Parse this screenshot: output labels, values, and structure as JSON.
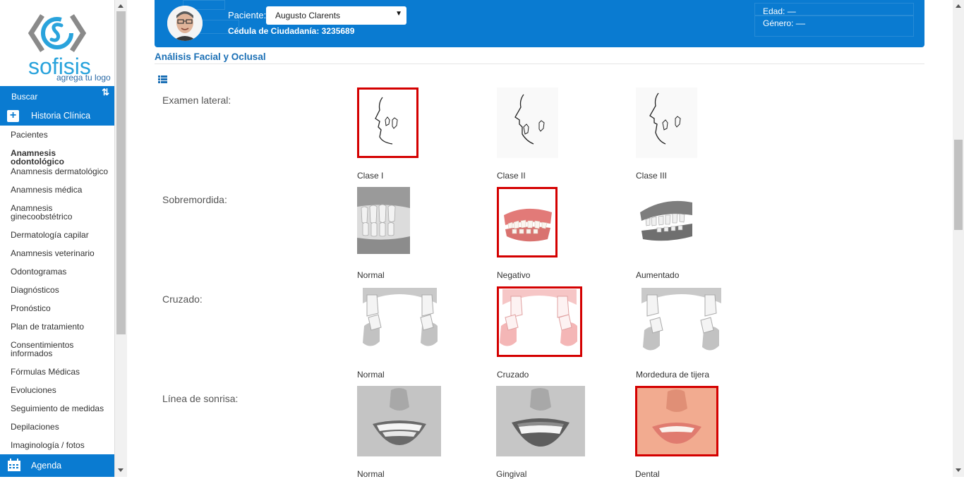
{
  "sidebar": {
    "logo": {
      "brand": "sofisis",
      "tagline": "agrega tu logo"
    },
    "search_label": "Buscar",
    "section_label": "Historia Clínica",
    "items": [
      {
        "label": "Pacientes"
      },
      {
        "label": "Anamnesis odontológico"
      },
      {
        "label": "Anamnesis dermatológico"
      },
      {
        "label": "Anamnesis médica"
      },
      {
        "label": "Anamnesis ginecoobstétrico"
      },
      {
        "label": "Dermatología capilar"
      },
      {
        "label": "Anamnesis veterinario"
      },
      {
        "label": "Odontogramas"
      },
      {
        "label": "Diagnósticos"
      },
      {
        "label": "Pronóstico"
      },
      {
        "label": "Plan de tratamiento"
      },
      {
        "label": "Consentimientos informados"
      },
      {
        "label": "Fórmulas Médicas"
      },
      {
        "label": "Evoluciones"
      },
      {
        "label": "Seguimiento de medidas"
      },
      {
        "label": "Depilaciones"
      },
      {
        "label": "Imaginología / fotos"
      }
    ],
    "active_item": "Anamnesis odontológico",
    "agenda_label": "Agenda"
  },
  "patient": {
    "label": "Paciente:",
    "selected": "Augusto Clarents",
    "cedula": "Cédula de Ciudadanía: 3235689",
    "edad": "Edad: —",
    "genero": "Género: ––"
  },
  "section": {
    "title": "Análisis Facial y Oclusal"
  },
  "rows": [
    {
      "label": "Examen lateral:",
      "options": [
        {
          "caption": "Clase I",
          "selected": true
        },
        {
          "caption": "Clase II",
          "selected": false
        },
        {
          "caption": "Clase III",
          "selected": false
        }
      ]
    },
    {
      "label": "Sobremordida:",
      "options": [
        {
          "caption": "Normal",
          "selected": false
        },
        {
          "caption": "Negativo",
          "selected": true
        },
        {
          "caption": "Aumentado",
          "selected": false
        }
      ]
    },
    {
      "label": "Cruzado:",
      "options": [
        {
          "caption": "Normal",
          "selected": false
        },
        {
          "caption": "Cruzado",
          "selected": true
        },
        {
          "caption": "Mordedura de tijera",
          "selected": false
        }
      ]
    },
    {
      "label": "Línea de sonrisa:",
      "options": [
        {
          "caption": "Normal",
          "selected": false
        },
        {
          "caption": "Gingival",
          "selected": false
        },
        {
          "caption": "Dental",
          "selected": true
        }
      ]
    }
  ],
  "colors": {
    "primary": "#0a7bd1",
    "selected_outline": "#d40000",
    "title": "#1a6fb5"
  }
}
